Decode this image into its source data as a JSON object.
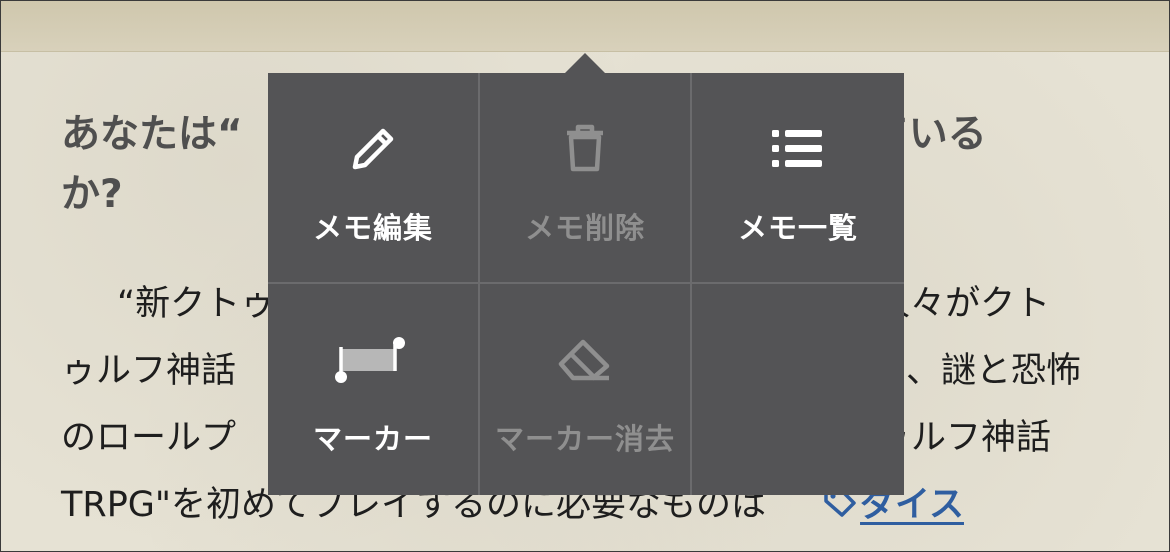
{
  "article": {
    "heading_line1": "あなたは“",
    "heading_line1_end": "っている",
    "heading_line2": "か?",
    "para_line1_start": "“新クトゥ",
    "para_line1_end": "人々がクト",
    "para_line2_start": "ゥルフ神話",
    "para_line2_end": "、謎と恐怖",
    "para_line3_start": "のロールプ",
    "para_line3_end": "ゥルフ神話",
    "para_line4": "TRPG\"を初めてプレイするのに必要なものは",
    "link_label": "ダイス"
  },
  "popup": {
    "items": [
      {
        "label": "メモ編集",
        "icon": "pencil-icon",
        "enabled": true
      },
      {
        "label": "メモ削除",
        "icon": "trash-icon",
        "enabled": false
      },
      {
        "label": "メモ一覧",
        "icon": "list-icon",
        "enabled": true
      },
      {
        "label": "マーカー",
        "icon": "marker-icon",
        "enabled": true
      },
      {
        "label": "マーカー消去",
        "icon": "eraser-icon",
        "enabled": false
      },
      {
        "label": "",
        "icon": "",
        "enabled": false
      }
    ]
  },
  "colors": {
    "menu_bg": "#545456",
    "menu_text": "#ffffff",
    "menu_disabled": "#8f8f8f",
    "link": "#2f5ea0",
    "page_bg": "#e6e2d4"
  }
}
